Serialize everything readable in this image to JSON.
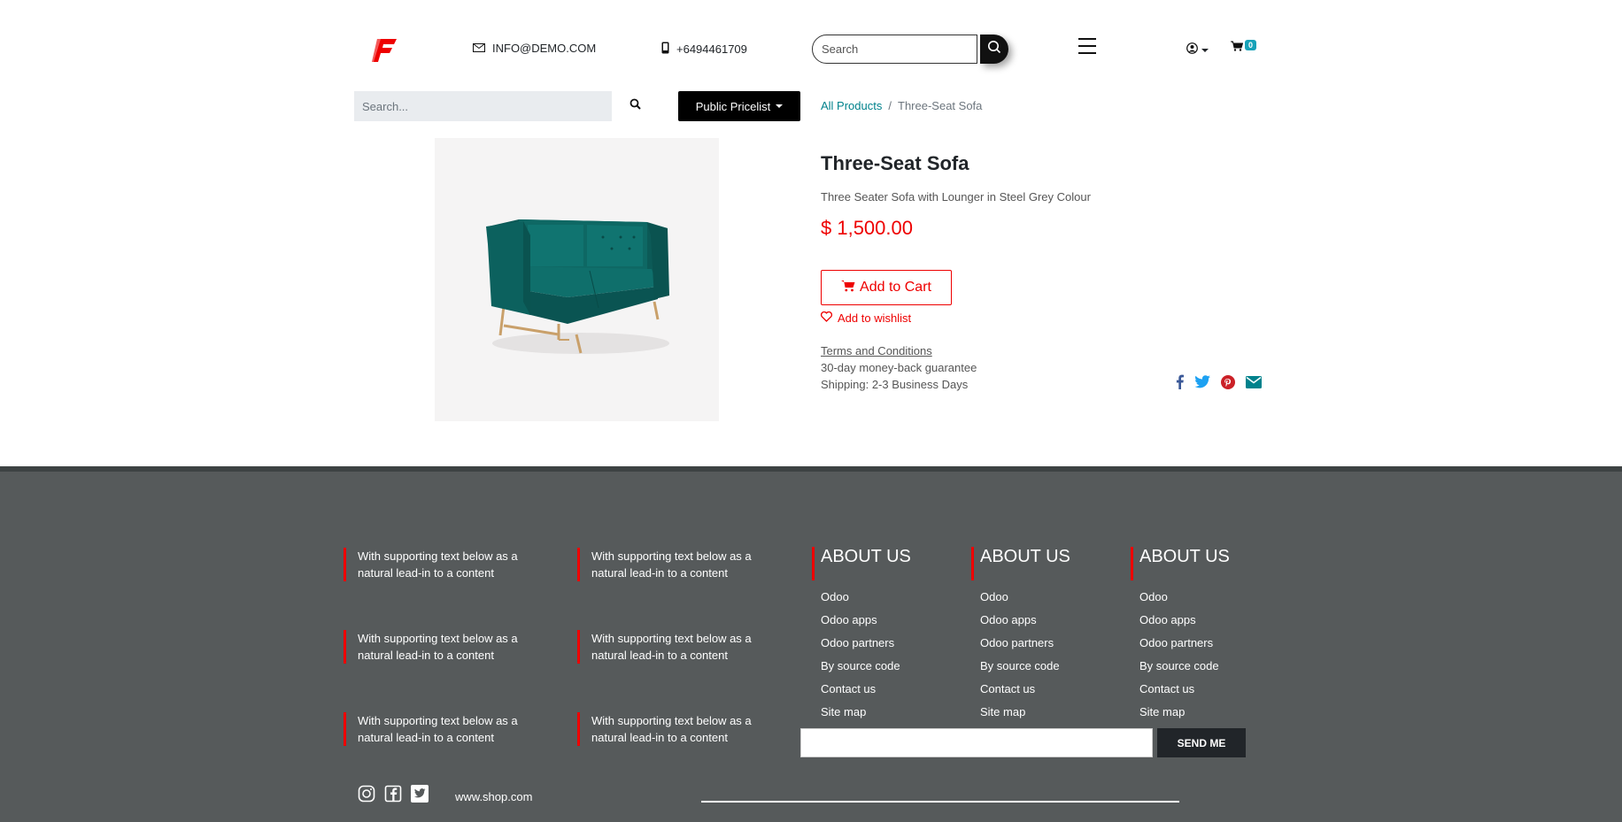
{
  "header": {
    "logo_icon": "brand-logo-icon",
    "email": "INFO@DEMO.COM",
    "phone": "+6494461709",
    "search_placeholder": "Search",
    "cart_count": "0"
  },
  "toolbar": {
    "search_placeholder": "Search...",
    "pricelist_label": "Public Pricelist"
  },
  "breadcrumb": {
    "parent": "All Products",
    "separator": "/",
    "current": "Three-Seat Sofa"
  },
  "product": {
    "title": "Three-Seat Sofa",
    "description": "Three Seater Sofa with Lounger in Steel Grey Colour",
    "price": "$ 1,500.00",
    "add_to_cart": "Add to Cart",
    "wishlist": "Add to wishlist",
    "terms": "Terms and Conditions",
    "guarantee": "30-day money-back guarantee",
    "shipping": "Shipping: 2-3 Business Days",
    "share_icons": [
      "facebook-icon",
      "twitter-icon",
      "pinterest-icon",
      "envelope-icon"
    ]
  },
  "footer": {
    "features": [
      "With supporting text below as a natural lead-in to a content",
      "With supporting text below as a natural lead-in to a content",
      "With supporting text below as a natural lead-in to a content",
      "With supporting text below as a natural lead-in to a content",
      "With supporting text below as a natural lead-in to a content",
      "With supporting text below as a natural lead-in to a content"
    ],
    "about_columns": [
      {
        "title": "ABOUT US",
        "links": [
          "Odoo",
          "Odoo apps",
          "Odoo partners",
          "By source code",
          "Contact us",
          "Site map"
        ]
      },
      {
        "title": "ABOUT US",
        "links": [
          "Odoo",
          "Odoo apps",
          "Odoo partners",
          "By source code",
          "Contact us",
          "Site map"
        ]
      },
      {
        "title": "ABOUT US",
        "links": [
          "Odoo",
          "Odoo apps",
          "Odoo partners",
          "By source code",
          "Contact us",
          "Site map"
        ]
      }
    ],
    "send_label": "SEND ME",
    "site_url": "www.shop.com"
  },
  "colors": {
    "accent_red": "#ee0000",
    "teal_link": "#00828c",
    "footer_bg": "#565a5b"
  }
}
